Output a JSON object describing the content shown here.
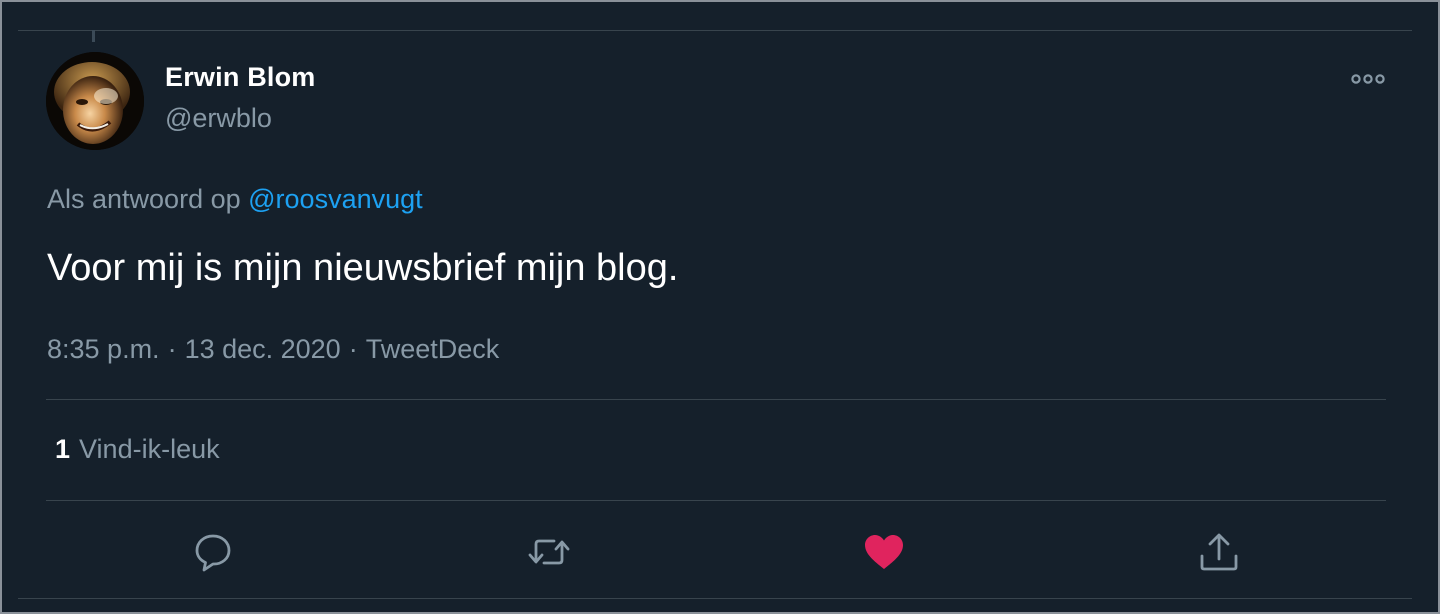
{
  "author": {
    "name": "Erwin Blom",
    "handle": "@erwblo"
  },
  "reply": {
    "prefix": "Als antwoord op",
    "mention": "@roosvanvugt"
  },
  "tweet": {
    "text": "Voor mij is mijn nieuwsbrief mijn blog."
  },
  "meta": {
    "time": "8:35 p.m.",
    "separator": "·",
    "date": "13 dec. 2020",
    "source": "TweetDeck"
  },
  "stats": {
    "likes_count": "1",
    "likes_label": "Vind-ik-leuk"
  },
  "actions": {
    "reply_icon": "speech-bubble-icon",
    "retweet_icon": "retweet-arrows-icon",
    "like_icon": "heart-icon",
    "share_icon": "share-upload-icon"
  },
  "colors": {
    "background": "#15202b",
    "text": "#ffffff",
    "secondary": "#8899a6",
    "link": "#1da1f2",
    "liked": "#e0245e",
    "divider": "#38444d"
  }
}
